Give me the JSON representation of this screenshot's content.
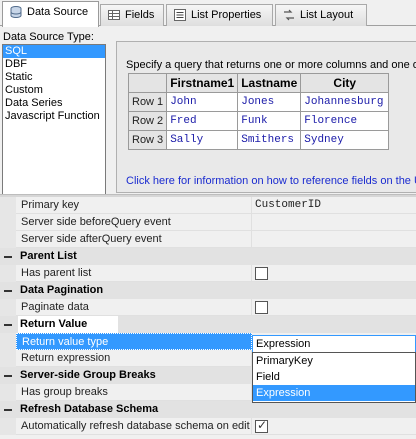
{
  "tabs": [
    {
      "label": "Data Source",
      "icon": "database-icon",
      "active": true
    },
    {
      "label": "Fields",
      "icon": "fields-icon",
      "active": false
    },
    {
      "label": "List Properties",
      "icon": "properties-icon",
      "active": false
    },
    {
      "label": "List Layout",
      "icon": "layout-icon",
      "active": false
    }
  ],
  "datasource": {
    "label": "Data Source Type:",
    "items": [
      "SQL",
      "DBF",
      "Static",
      "Custom",
      "Data Series",
      "Javascript Function"
    ],
    "selected": "SQL"
  },
  "query": {
    "instruction": "Specify a query that returns one or more columns and one or",
    "table": {
      "headers": [
        "Firstname1",
        "Lastname",
        "City"
      ],
      "rows": [
        {
          "label": "Row 1",
          "cells": [
            "John",
            "Jones",
            "Johannesburg"
          ]
        },
        {
          "label": "Row 2",
          "cells": [
            "Fred",
            "Funk",
            "Florence"
          ]
        },
        {
          "label": "Row 3",
          "cells": [
            "Sally",
            "Smithers",
            "Sydney"
          ]
        }
      ]
    },
    "help_link": "Click here for information on how to reference fields on the U"
  },
  "properties": {
    "primary_key": {
      "label": "Primary key",
      "value": "CustomerID"
    },
    "before_query": {
      "label": "Server side beforeQuery event"
    },
    "after_query": {
      "label": "Server side afterQuery event"
    },
    "parent_list": {
      "category": "Parent List",
      "has_parent_label": "Has parent list",
      "has_parent_checked": false
    },
    "pagination": {
      "category": "Data Pagination",
      "paginate_label": "Paginate data",
      "paginate_checked": false
    },
    "return_value": {
      "category": "Return Value",
      "type_label": "Return value type",
      "type_value": "Expression",
      "expression_label": "Return expression",
      "options": [
        "PrimaryKey",
        "Field",
        "Expression"
      ],
      "selected_option": "Expression"
    },
    "group_breaks": {
      "category": "Server-side Group Breaks",
      "has_label": "Has group breaks"
    },
    "refresh": {
      "category": "Refresh Database Schema",
      "auto_label": "Automatically refresh database schema on edit",
      "auto_checked": true
    }
  },
  "colors": {
    "selection": "#3399ff",
    "link": "#1a2bd0",
    "cell_text": "#1a1aa8"
  }
}
